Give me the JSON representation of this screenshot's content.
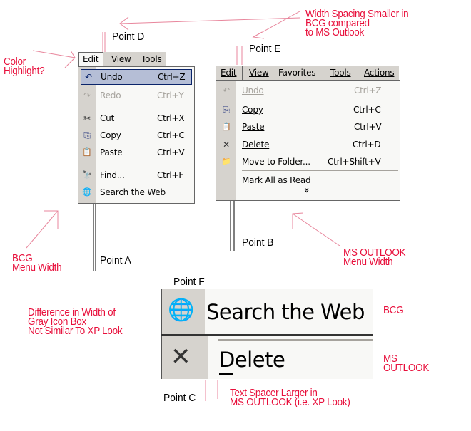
{
  "annotations": {
    "color_highlight": [
      "Color",
      "Highlight?"
    ],
    "width_spacing": [
      "Width Spacing Smaller in",
      "BCG compared",
      "to MS Outlook"
    ],
    "bcg_menu_width": [
      "BCG",
      "Menu Width"
    ],
    "outlook_menu_width": [
      "MS OUTLOOK",
      "Menu Width"
    ],
    "gray_icon_box": [
      "Difference in Width of",
      "Gray Icon Box",
      "Not Similar To XP Look"
    ],
    "text_spacer": [
      "Text Spacer Larger in",
      "MS OUTLOOK (i.e. XP Look)"
    ],
    "bcg_label": "BCG",
    "outlook_label": [
      "MS",
      "OUTLOOK"
    ]
  },
  "points": {
    "a": "Point A",
    "b": "Point B",
    "c": "Point C",
    "d": "Point D",
    "e": "Point E",
    "f": "Point F"
  },
  "bcg_menu": {
    "menubar": [
      {
        "label": "Edit",
        "active": true
      },
      {
        "label": "View"
      },
      {
        "label": "Tools"
      }
    ],
    "items": [
      {
        "icon": "undo-icon",
        "glyph": "↶",
        "label": "Undo",
        "shortcut": "Ctrl+Z",
        "highlighted": true
      },
      {
        "icon": "redo-icon",
        "glyph": "↷",
        "label": "Redo",
        "shortcut": "Ctrl+Y",
        "disabled": true
      },
      {
        "icon": "cut-icon",
        "glyph": "✂",
        "label": "Cut",
        "shortcut": "Ctrl+X"
      },
      {
        "icon": "copy-icon",
        "glyph": "⎘",
        "label": "Copy",
        "shortcut": "Ctrl+C"
      },
      {
        "icon": "paste-icon",
        "glyph": "📋",
        "label": "Paste",
        "shortcut": "Ctrl+V"
      },
      {
        "icon": "find-icon",
        "glyph": "🔭",
        "label": "Find...",
        "shortcut": "Ctrl+F"
      },
      {
        "icon": "search-web-icon",
        "glyph": "🌐",
        "label": "Search the Web",
        "shortcut": ""
      }
    ],
    "highlight_color": "#b5bed6",
    "highlight_border": "#0a246a"
  },
  "outlook_menu": {
    "menubar": [
      {
        "label": "Edit",
        "active": true
      },
      {
        "label": "View"
      },
      {
        "label": "Favorites"
      },
      {
        "label": "Tools"
      },
      {
        "label": "Actions"
      }
    ],
    "items": [
      {
        "icon": "undo-icon",
        "glyph": "↶",
        "label": "Undo",
        "shortcut": "Ctrl+Z",
        "disabled": true
      },
      {
        "icon": "copy-icon",
        "glyph": "⎘",
        "label": "Copy",
        "shortcut": "Ctrl+C"
      },
      {
        "icon": "paste-icon",
        "glyph": "📋",
        "label": "Paste",
        "shortcut": "Ctrl+V"
      },
      {
        "icon": "delete-icon",
        "glyph": "✕",
        "label": "Delete",
        "shortcut": "Ctrl+D"
      },
      {
        "icon": "move-to-folder-icon",
        "glyph": "📁",
        "label": "Move to Folder...",
        "shortcut": "Ctrl+Shift+V"
      },
      {
        "icon": "",
        "glyph": "",
        "label": "Mark All as Read",
        "shortcut": ""
      }
    ],
    "expand_glyph": "»"
  },
  "comparison": {
    "bcg_item": {
      "label": "Search the Web",
      "glyph": "🌐"
    },
    "outlook_item": {
      "label": "Delete",
      "glyph": "✕"
    }
  }
}
